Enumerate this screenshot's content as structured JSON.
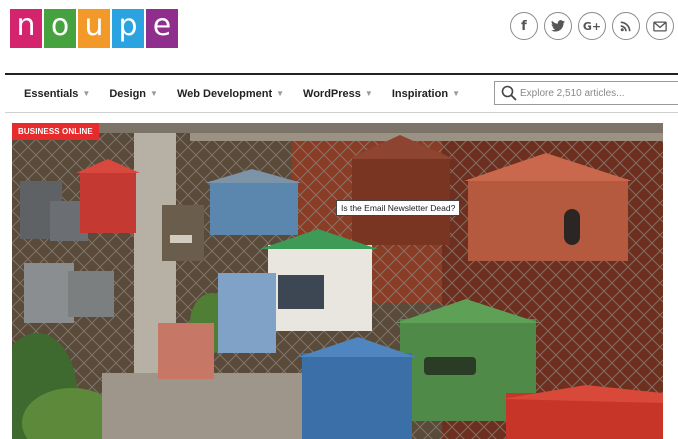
{
  "logo": {
    "letters": [
      {
        "char": "n",
        "color": "#d5246e"
      },
      {
        "char": "o",
        "color": "#45a23f"
      },
      {
        "char": "u",
        "color": "#f3992a"
      },
      {
        "char": "p",
        "color": "#2aa3e0"
      },
      {
        "char": "e",
        "color": "#8f2e8c"
      }
    ]
  },
  "social": [
    {
      "icon": "facebook-icon",
      "glyph": "f"
    },
    {
      "icon": "twitter-icon",
      "glyph": "t"
    },
    {
      "icon": "googleplus-icon",
      "glyph": "G+"
    },
    {
      "icon": "rss-icon",
      "glyph": "rss"
    },
    {
      "icon": "mail-icon",
      "glyph": "mail"
    }
  ],
  "nav": {
    "items": [
      {
        "label": "Essentials"
      },
      {
        "label": "Design"
      },
      {
        "label": "Web Development"
      },
      {
        "label": "WordPress"
      },
      {
        "label": "Inspiration"
      }
    ],
    "search_placeholder": "Explore 2,510 articles..."
  },
  "hero": {
    "category": "BUSINESS ONLINE",
    "caption": "Is the Email Newsletter Dead?"
  }
}
